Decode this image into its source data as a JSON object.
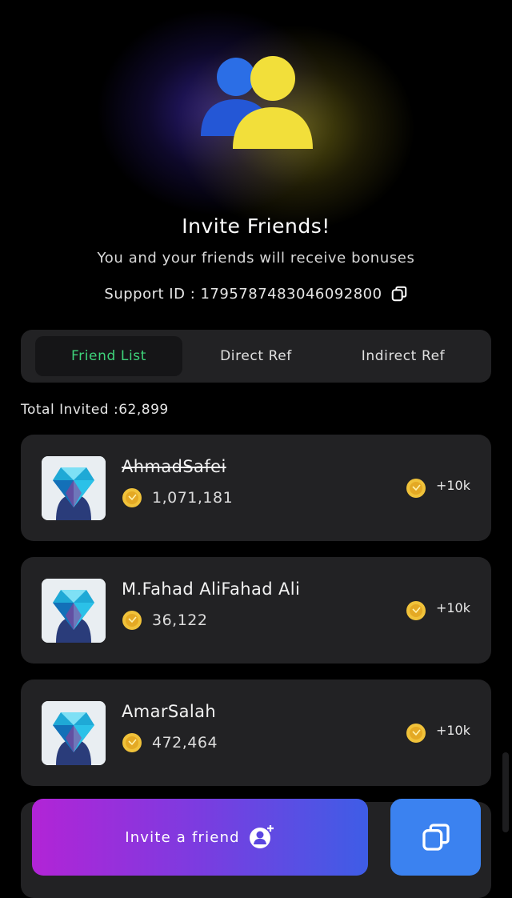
{
  "header": {
    "title": "Invite Friends!",
    "subtitle": "You and your friends will receive bonuses",
    "support_label": "Support ID : ",
    "support_id": "1795787483046092800"
  },
  "tabs": [
    {
      "label": "Friend List",
      "active": true
    },
    {
      "label": "Direct Ref",
      "active": false
    },
    {
      "label": "Indirect Ref",
      "active": false
    }
  ],
  "total_invited": "Total Invited :62,899",
  "friends": [
    {
      "name": "AhmadSafei",
      "strikethrough": true,
      "score": "1,071,181",
      "reward": "+10k"
    },
    {
      "name": "M.Fahad AliFahad Ali",
      "strikethrough": false,
      "score": "36,122",
      "reward": "+10k"
    },
    {
      "name": "AmarSalah",
      "strikethrough": false,
      "score": "472,464",
      "reward": "+10k"
    }
  ],
  "actions": {
    "invite_label": "Invite a friend"
  },
  "colors": {
    "background": "#000000",
    "card": "#222224",
    "active_tab_text": "#3ed37a",
    "coin": "#f0c23a",
    "gradient_start": "#b224d6",
    "gradient_end": "#3e5de6",
    "copy_button": "#3b82f0",
    "friend_icon_blue": "#2b6ee6",
    "friend_icon_yellow": "#f2df3a"
  },
  "icons": {
    "hero": "friends-icon",
    "copy": "copy-icon",
    "coin": "coin-icon",
    "add_user": "add-user-icon"
  }
}
